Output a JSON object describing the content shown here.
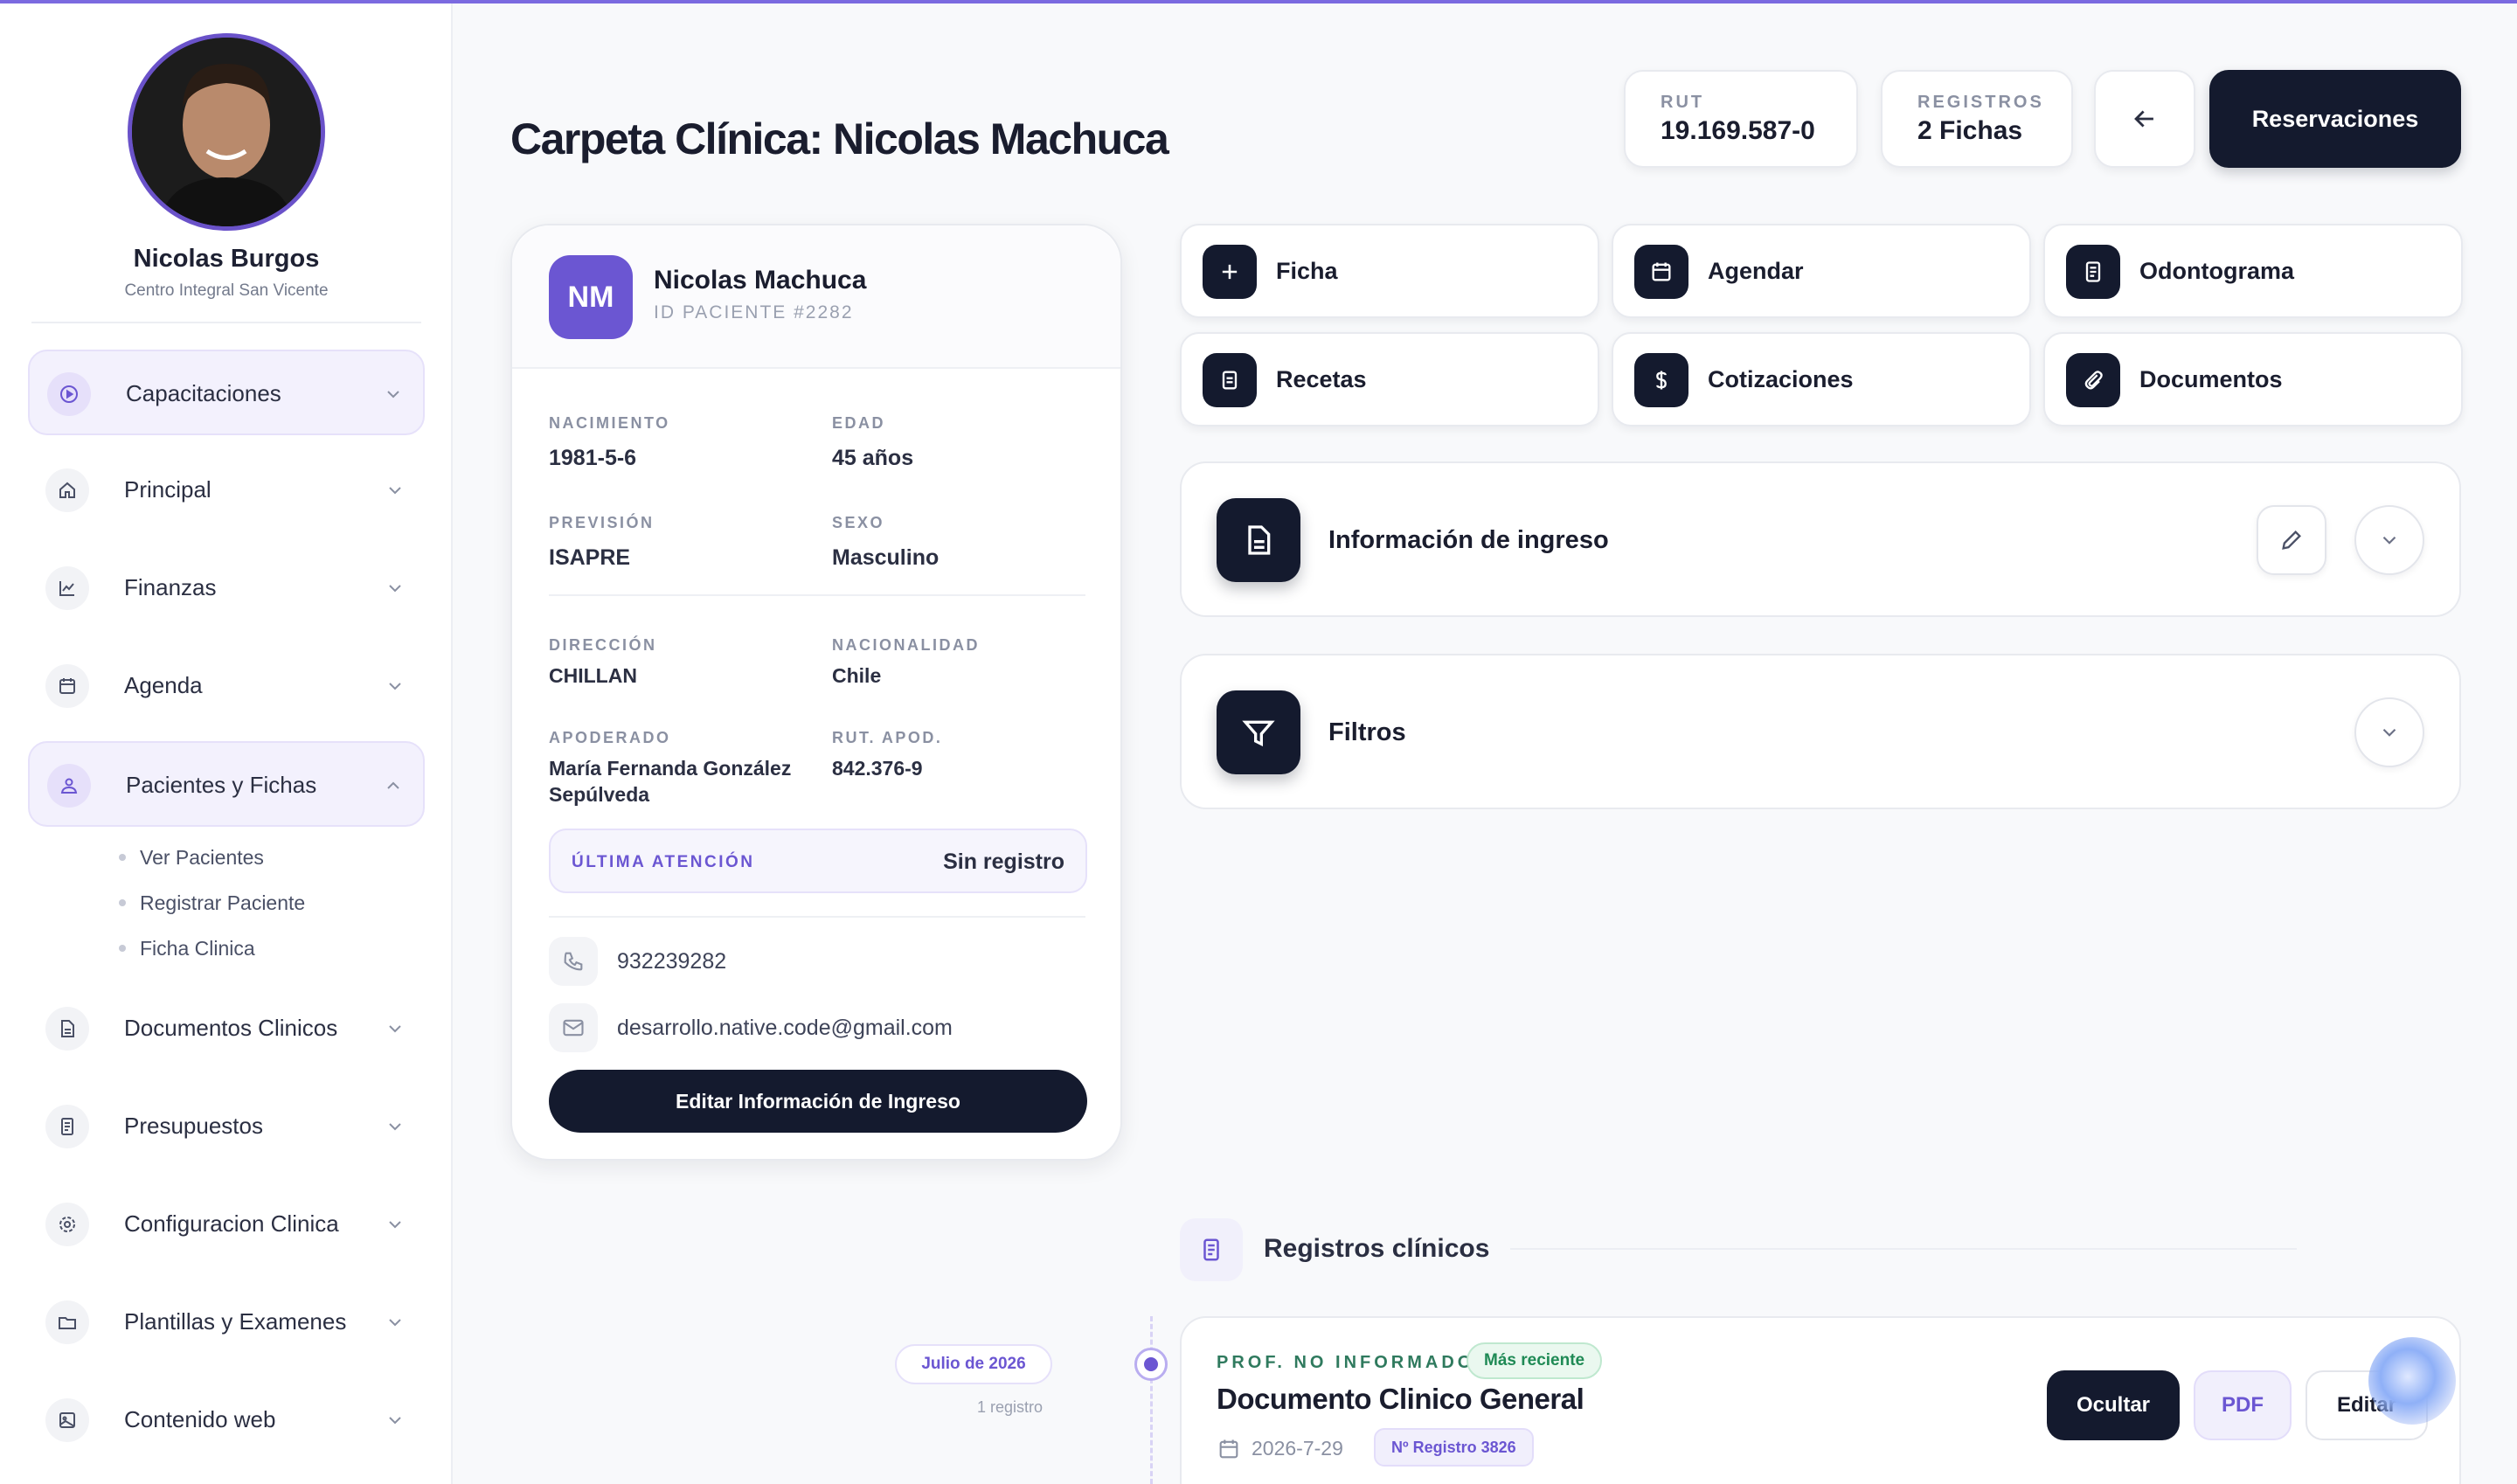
{
  "user": {
    "name": "Nicolas Burgos",
    "org": "Centro Integral San Vicente"
  },
  "nav": {
    "items": [
      {
        "label": "Capacitaciones",
        "icon": "play-circle-icon"
      },
      {
        "label": "Principal",
        "icon": "home-icon"
      },
      {
        "label": "Finanzas",
        "icon": "chart-line-icon"
      },
      {
        "label": "Agenda",
        "icon": "calendar-icon"
      },
      {
        "label": "Pacientes y Fichas",
        "icon": "users-icon"
      },
      {
        "label": "Documentos Clinicos",
        "icon": "file-icon"
      },
      {
        "label": "Presupuestos",
        "icon": "receipt-icon"
      },
      {
        "label": "Configuracion Clinica",
        "icon": "gear-icon"
      },
      {
        "label": "Plantillas y Examenes",
        "icon": "folder-icon"
      },
      {
        "label": "Contenido web",
        "icon": "image-icon"
      }
    ],
    "sub_items": [
      "Ver Pacientes",
      "Registrar Paciente",
      "Ficha Clinica"
    ]
  },
  "header": {
    "title": "Carpeta Clínica: Nicolas Machuca",
    "rut_label": "RUT",
    "rut_value": "19.169.587-0",
    "registros_label": "REGISTROS",
    "registros_value": "2 Fichas",
    "reservaciones_label": "Reservaciones"
  },
  "patient": {
    "initials": "NM",
    "name": "Nicolas Machuca",
    "id_label": "ID PACIENTE #2282",
    "fields": {
      "nacimiento_label": "NACIMIENTO",
      "nacimiento": "1981-5-6",
      "edad_label": "EDAD",
      "edad": "45 años",
      "prevision_label": "PREVISIÓN",
      "prevision": "ISAPRE",
      "sexo_label": "SEXO",
      "sexo": "Masculino",
      "direccion_label": "DIRECCIÓN",
      "direccion": "CHILLAN",
      "nacionalidad_label": "NACIONALIDAD",
      "nacionalidad": "Chile",
      "apoderado_label": "APODERADO",
      "apoderado_1": "María Fernanda González",
      "apoderado_2": "Sepúlveda",
      "rut_apod_label": "RUT. APOD.",
      "rut_apod": "842.376-9"
    },
    "last_attention_label": "ÚLTIMA ATENCIÓN",
    "last_attention_value": "Sin registro",
    "phone": "932239282",
    "email": "desarrollo.native.code@gmail.com",
    "edit_button": "Editar Información de Ingreso"
  },
  "actions": [
    {
      "label": "Ficha",
      "icon": "plus-icon"
    },
    {
      "label": "Agendar",
      "icon": "calendar-icon"
    },
    {
      "label": "Odontograma",
      "icon": "document-icon"
    },
    {
      "label": "Recetas",
      "icon": "prescription-icon"
    },
    {
      "label": "Cotizaciones",
      "icon": "dollar-icon"
    },
    {
      "label": "Documentos",
      "icon": "paperclip-icon"
    }
  ],
  "panels": {
    "ingreso_title": "Información de ingreso",
    "filtros_title": "Filtros"
  },
  "records": {
    "section_title": "Registros clínicos",
    "group_date": "Julio de 2026",
    "group_count": "1 registro",
    "items": [
      {
        "professional": "PROF. NO INFORMADO",
        "badge": "Más reciente",
        "title": "Documento Clinico General",
        "date": "2026-7-29",
        "registro": "Nº Registro 3826",
        "btn_hide": "Ocultar",
        "btn_pdf": "PDF",
        "btn_edit": "Editar"
      }
    ]
  },
  "colors": {
    "accent": "#6b56d2",
    "dark": "#141a2e",
    "success": "#1f8a55"
  }
}
